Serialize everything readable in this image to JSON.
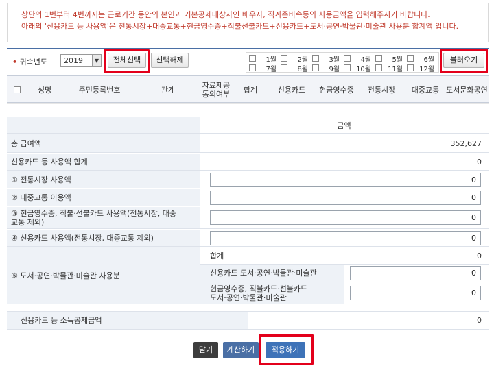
{
  "notice": {
    "line1": "상단의 1번부터 4번까지는 근로기간 동안의 본인과 기본공제대상자인 배우자, 직계존비속등의 사용금액을 입력해주시기 바랍니다.",
    "line2": "아래의 '신용카드 등 사용액'은 전통시장+대중교통+현금영수증+직불선불카드+신용카드+도서·공연·박물관·미술관 사용분 합계액 입니다."
  },
  "filter": {
    "year_label": "귀속년도",
    "year_value": "2019",
    "select_all": "전체선택",
    "deselect": "선택해제",
    "load": "불러오기",
    "months": [
      "1월",
      "2월",
      "3월",
      "4월",
      "5월",
      "6월",
      "7월",
      "8월",
      "9월",
      "10월",
      "11월",
      "12월"
    ]
  },
  "grid_headers": [
    "성명",
    "주민등록번호",
    "관계",
    "자료제공\n동의여부",
    "합계",
    "신용카드",
    "현금영수증",
    "전통시장",
    "대중교통",
    "도서문화공연"
  ],
  "amounts": {
    "column_header": "금액",
    "total_salary_label": "총 급여액",
    "total_salary_value": "352,627",
    "card_total_label": "신용카드 등 사용액 합계",
    "card_total_value": "0",
    "traditional_label": "① 전통시장 사용액",
    "traditional_value": "0",
    "transit_label": "② 대중교통 이용액",
    "transit_value": "0",
    "cash_label_1": "③ 현금영수증, 직불·선불카드 사용액(전통시장, 대중",
    "cash_label_2": "교통 제외)",
    "cash_value": "0",
    "credit_label": "④ 신용카드 사용액(전통시장, 대중교통 제외)",
    "credit_value": "0",
    "culture_label": "⑤ 도서·공연·박물관·미술관 사용분",
    "culture_sum_label": "합계",
    "culture_sum_value": "0",
    "culture_card_label": "신용카드 도서·공연·박물관·미술관",
    "culture_card_value": "0",
    "culture_cash_label_1": "현금영수증, 직불카드·선불카드",
    "culture_cash_label_2": "도서·공연·박물관·미술관",
    "culture_cash_value": "0",
    "deduction_label": "신용카드 등 소득공제금액",
    "deduction_value": "0"
  },
  "buttons": {
    "close": "닫기",
    "calculate": "계산하기",
    "apply": "적용하기"
  },
  "colors": {
    "highlight": "#e3001b",
    "close_button": "#3d3d3d",
    "calc_button": "#4a6fa5",
    "apply_button": "#3e73b8"
  }
}
